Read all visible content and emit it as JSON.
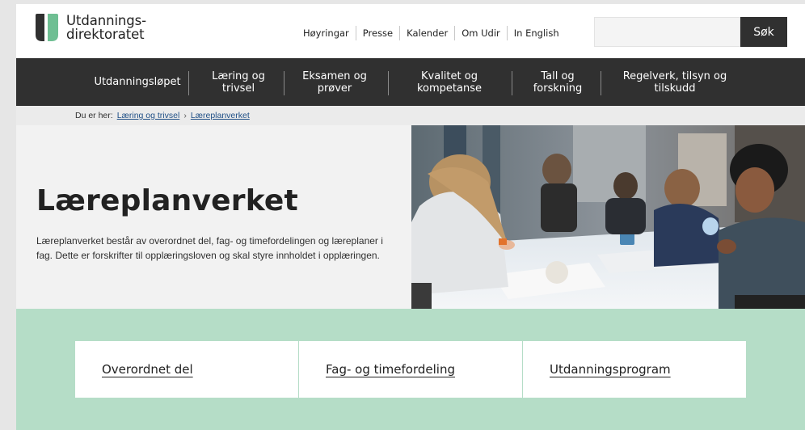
{
  "header": {
    "logo_line1": "Utdannings-",
    "logo_line2": "direktoratet",
    "top_links": [
      "Høyringar",
      "Presse",
      "Kalender",
      "Om Udir",
      "In English"
    ],
    "search": {
      "placeholder": "",
      "value": "",
      "button_label": "Søk"
    }
  },
  "nav": {
    "items": [
      {
        "line1": "Utdanningsløpet",
        "line2": ""
      },
      {
        "line1": "Læring og",
        "line2": "trivsel"
      },
      {
        "line1": "Eksamen og",
        "line2": "prøver"
      },
      {
        "line1": "Kvalitet og",
        "line2": "kompetanse"
      },
      {
        "line1": "Tall og",
        "line2": "forskning"
      },
      {
        "line1": "Regelverk, tilsyn og",
        "line2": "tilskudd"
      }
    ]
  },
  "breadcrumb": {
    "prefix": "Du er her:",
    "items": [
      "Læring og trivsel",
      "Læreplanverket"
    ],
    "separator": "›"
  },
  "hero": {
    "title": "Læreplanverket",
    "text": "Læreplanverket består av overordnet del, fag- og timefordelingen og læreplaner i fag. Dette er forskrifter til opplæringsloven og skal styre innholdet i opplæringen."
  },
  "links": {
    "items": [
      "Overordnet del",
      "Fag- og timefordeling",
      "Utdanningsprogram"
    ]
  },
  "colors": {
    "nav_bg": "#303030",
    "hero_bg": "#f2f2f2",
    "links_bg": "#b5ddc7",
    "link_blue": "#1f4f86",
    "logo_dark": "#303030",
    "logo_green": "#6fbf93"
  }
}
